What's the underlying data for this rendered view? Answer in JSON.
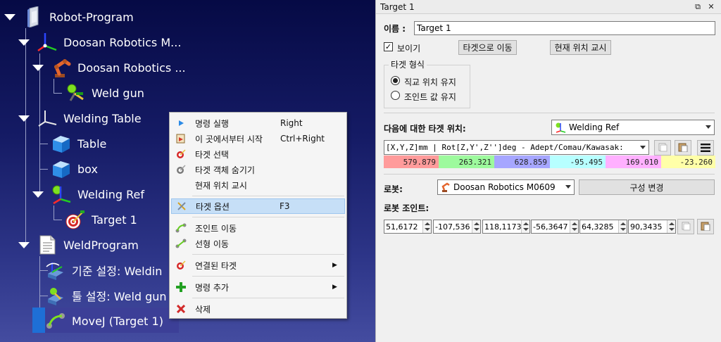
{
  "tree": {
    "nodes": [
      {
        "label": "Robot-Program",
        "icon": "program-station-icon"
      },
      {
        "label": "Doosan Robotics M...",
        "icon": "robot-frame-icon"
      },
      {
        "label": "Doosan Robotics ...",
        "icon": "robot-arm-icon"
      },
      {
        "label": "Weld gun",
        "icon": "weld-gun-icon"
      },
      {
        "label": "Welding Table",
        "icon": "reference-frame-icon"
      },
      {
        "label": "Table",
        "icon": "cube-icon"
      },
      {
        "label": "box",
        "icon": "cube-icon"
      },
      {
        "label": "Welding Ref",
        "icon": "reference-frame-icon"
      },
      {
        "label": "Target 1",
        "icon": "target-icon"
      },
      {
        "label": "WeldProgram",
        "icon": "program-file-icon"
      },
      {
        "label": "기준 설정: Weldin",
        "icon": "set-reference-icon"
      },
      {
        "label": "툴 설정: Weld gun",
        "icon": "set-tool-icon"
      },
      {
        "label": "MoveJ (Target 1)",
        "icon": "movej-icon"
      }
    ]
  },
  "context_menu": {
    "items": [
      {
        "label": "명령 실행",
        "shortcut": "Right",
        "icon": "play-icon"
      },
      {
        "label": "이 곳에서부터 시작",
        "shortcut": "Ctrl+Right",
        "icon": "run-from-here-icon"
      },
      {
        "label": "타겟 선택",
        "shortcut": "",
        "icon": "target-icon"
      },
      {
        "label": "타겟 객체 숨기기",
        "shortcut": "",
        "icon": "target-hide-icon"
      },
      {
        "label": "현재 위치 교시",
        "shortcut": "",
        "icon": ""
      },
      {
        "label": "타겟 옵션",
        "shortcut": "F3",
        "icon": "target-options-icon"
      },
      {
        "label": "조인트 이동",
        "shortcut": "",
        "icon": "joint-move-icon"
      },
      {
        "label": "선형 이동",
        "shortcut": "",
        "icon": "linear-move-icon"
      },
      {
        "label": "연결된 타겟",
        "shortcut": "",
        "icon": "target-icon",
        "submenu": "▶"
      },
      {
        "label": "명령 추가",
        "shortcut": "",
        "icon": "plus-icon",
        "submenu": "▶"
      },
      {
        "label": "삭제",
        "shortcut": "",
        "icon": "delete-icon"
      }
    ]
  },
  "panel": {
    "title": "Target 1",
    "name_label": "이름 :",
    "name_value": "Target 1",
    "visible_label": "보이기",
    "visible_checked": "✓",
    "move_to_target_button": "타겟으로 이동",
    "teach_current_button": "현재 위치 교시",
    "target_type_title": "타겟 형식",
    "radio_cartesian": "직교 위치 유지",
    "radio_joint": "조인트 값 유지",
    "target_position_label": "다음에 대한 타겟 위치:",
    "reference_combo": "Welding Ref",
    "format_combo": "[X,Y,Z]mm | Rot[Z,Y',Z'']deg - Adept/Comau/Kawasak:",
    "pose_values": [
      {
        "value": "579.879",
        "color": "#ff9b9b"
      },
      {
        "value": "263.321",
        "color": "#9dfa9d"
      },
      {
        "value": "628.859",
        "color": "#a6a6ff"
      },
      {
        "value": "-95.495",
        "color": "#b7ffff"
      },
      {
        "value": "169.010",
        "color": "#ffb0ff"
      },
      {
        "value": "-23.260",
        "color": "#ffffa8"
      }
    ],
    "robot_label": "로봇:",
    "robot_combo": "Doosan Robotics M0609",
    "config_button": "구성 변경",
    "joints_label": "로봇 조인트:",
    "joints": [
      "51,6172",
      "-107,536",
      "118,1173",
      "-56,3647",
      "64,3285",
      "90,3435"
    ]
  }
}
